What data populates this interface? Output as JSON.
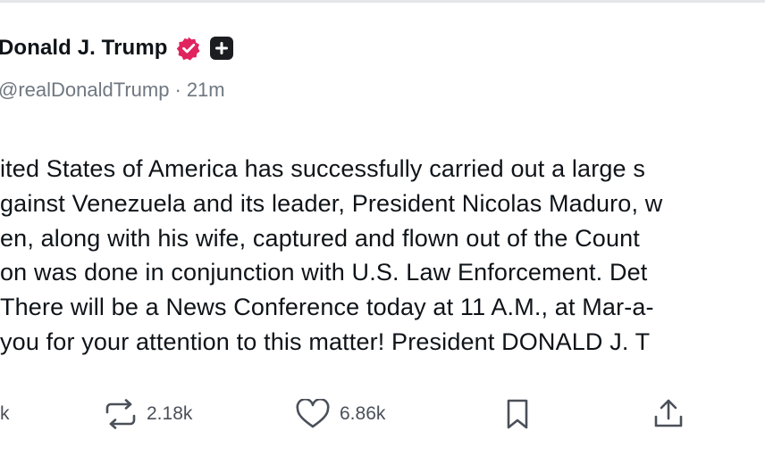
{
  "post": {
    "author": {
      "display_name": "Donald J. Trump",
      "handle": "@realDonaldTrump",
      "time_separator": "·",
      "timestamp": "21m",
      "verified_badge_icon": "verified-badge-icon",
      "plus_badge_icon": "plus-badge-icon"
    },
    "text_lines": [
      "ited States of America has successfully carried out a large s",
      "gainst Venezuela and its leader, President Nicolas Maduro, w",
      "en, along with his wife, captured and flown out of the Count",
      "on was done in conjunction with U.S. Law Enforcement. Det",
      "There will be a News Conference today at 11 A.M., at Mar-a-",
      "you for your attention to this matter! President DONALD J. T"
    ],
    "actions": {
      "replies_count": "k",
      "reposts_count": "2.18k",
      "likes_count": "6.86k",
      "reply_icon": "reply-icon",
      "repost_icon": "repost-icon",
      "like_icon": "heart-icon",
      "bookmark_icon": "bookmark-icon",
      "share_icon": "share-icon"
    }
  },
  "colors": {
    "verified_badge": "#e0245e",
    "plus_badge": "#1b1d20",
    "text_primary": "#0f1419",
    "text_secondary": "#6f7780",
    "action_icons": "#4a5059"
  }
}
